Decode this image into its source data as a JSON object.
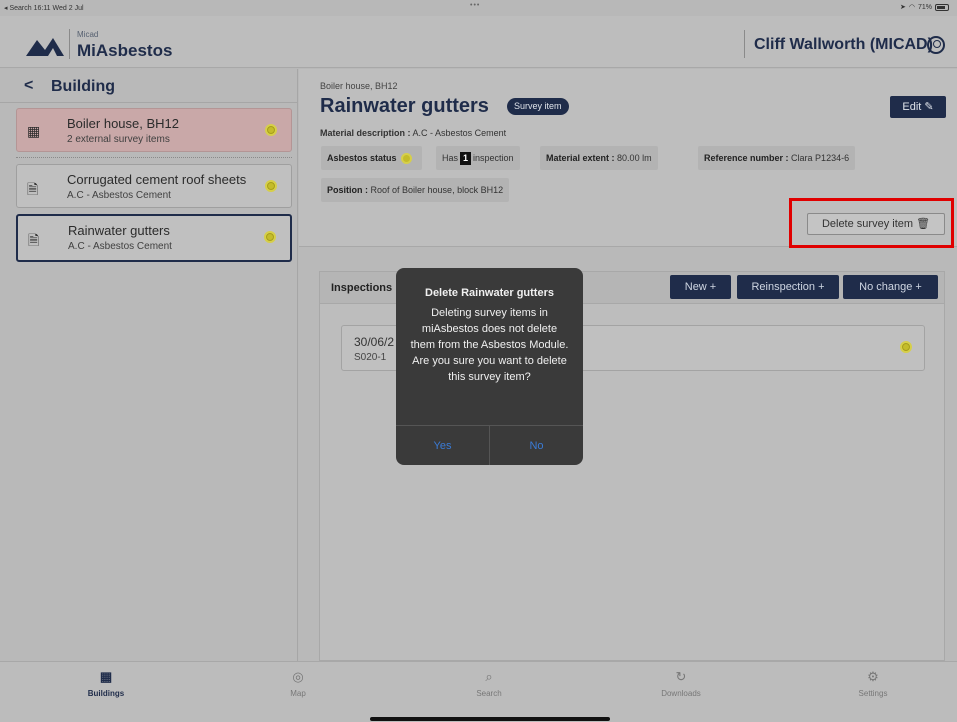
{
  "status_bar": {
    "left": "◂ Search  16:11  Wed 2 Jul",
    "center": "•••",
    "battery": "71%"
  },
  "header": {
    "logo_small": "Micad",
    "logo_big": "MiAsbestos",
    "user_name": "Cliff Wallworth (MICAD)"
  },
  "sidebar": {
    "title": "Building",
    "items": [
      {
        "title": "Boiler house, BH12",
        "subtitle": "2 external survey items"
      },
      {
        "title": "Corrugated cement roof sheets",
        "subtitle": "A.C - Asbestos Cement"
      },
      {
        "title": "Rainwater gutters",
        "subtitle": "A.C - Asbestos Cement"
      }
    ]
  },
  "detail": {
    "breadcrumb": "Boiler house, BH12",
    "title": "Rainwater gutters",
    "badge": "Survey item",
    "edit_label": "Edit ✎",
    "material_description_label": "Material description :",
    "material_description_value": "A.C - Asbestos Cement",
    "asbestos_status_label": "Asbestos status",
    "has_label": "Has",
    "inspection_count": "1",
    "inspection_label": "inspection",
    "material_extent_label": "Material extent :",
    "material_extent_value": "80.00 lm",
    "reference_label": "Reference number :",
    "reference_value": "Clara P1234-6",
    "position_label": "Position :",
    "position_value": "Roof of Boiler house, block BH12",
    "delete_label": "Delete survey item 🗑"
  },
  "inspections": {
    "title": "Inspections",
    "new_label": "New +",
    "reinspection_label": "Reinspection +",
    "no_change_label": "No change +",
    "rows": [
      {
        "date": "30/06/2",
        "code": "S020-1"
      }
    ]
  },
  "dialog": {
    "title": "Delete Rainwater gutters",
    "message": "Deleting survey items in miAsbestos does not delete them from the Asbestos Module.  Are you sure you want to delete this survey item?",
    "yes_label": "Yes",
    "no_label": "No"
  },
  "tabs": [
    {
      "label": "Buildings",
      "icon": "building-icon"
    },
    {
      "label": "Map",
      "icon": "map-icon"
    },
    {
      "label": "Search",
      "icon": "search-icon"
    },
    {
      "label": "Downloads",
      "icon": "sync-icon"
    },
    {
      "label": "Settings",
      "icon": "gear-icon"
    }
  ],
  "colors": {
    "brand_navy": "#1f2c4a",
    "status_yellow": "#c4bc2a",
    "highlight_red": "#e00000",
    "link_blue": "#3a7bd5"
  }
}
